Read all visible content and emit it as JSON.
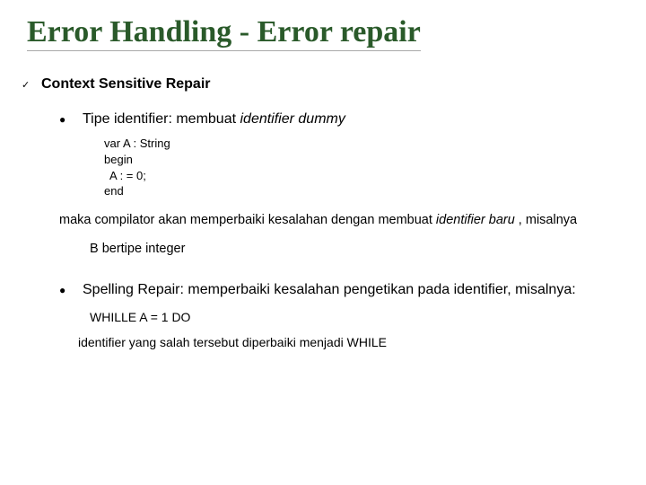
{
  "title": "Error Handling - Error repair",
  "lvl1": "Context Sensitive Repair",
  "item1": {
    "lead": "Tipe identifier: membuat ",
    "italic": "identifier dummy",
    "code": {
      "l1": "var A : String",
      "l2": "begin",
      "l3": "A : = 0;",
      "l4": "end"
    },
    "para_a": "maka compilator akan memperbaiki kesalahan dengan membuat ",
    "para_italic": "identifier baru",
    "para_b": " , misalnya",
    "para2": "B bertipe integer"
  },
  "item2": {
    "text": "Spelling Repair: memperbaiki kesalahan pengetikan pada identifier, misalnya:",
    "example": "WHILLE  A = 1 DO",
    "conclusion": "identifier yang salah tersebut diperbaiki menjadi  WHILE"
  }
}
